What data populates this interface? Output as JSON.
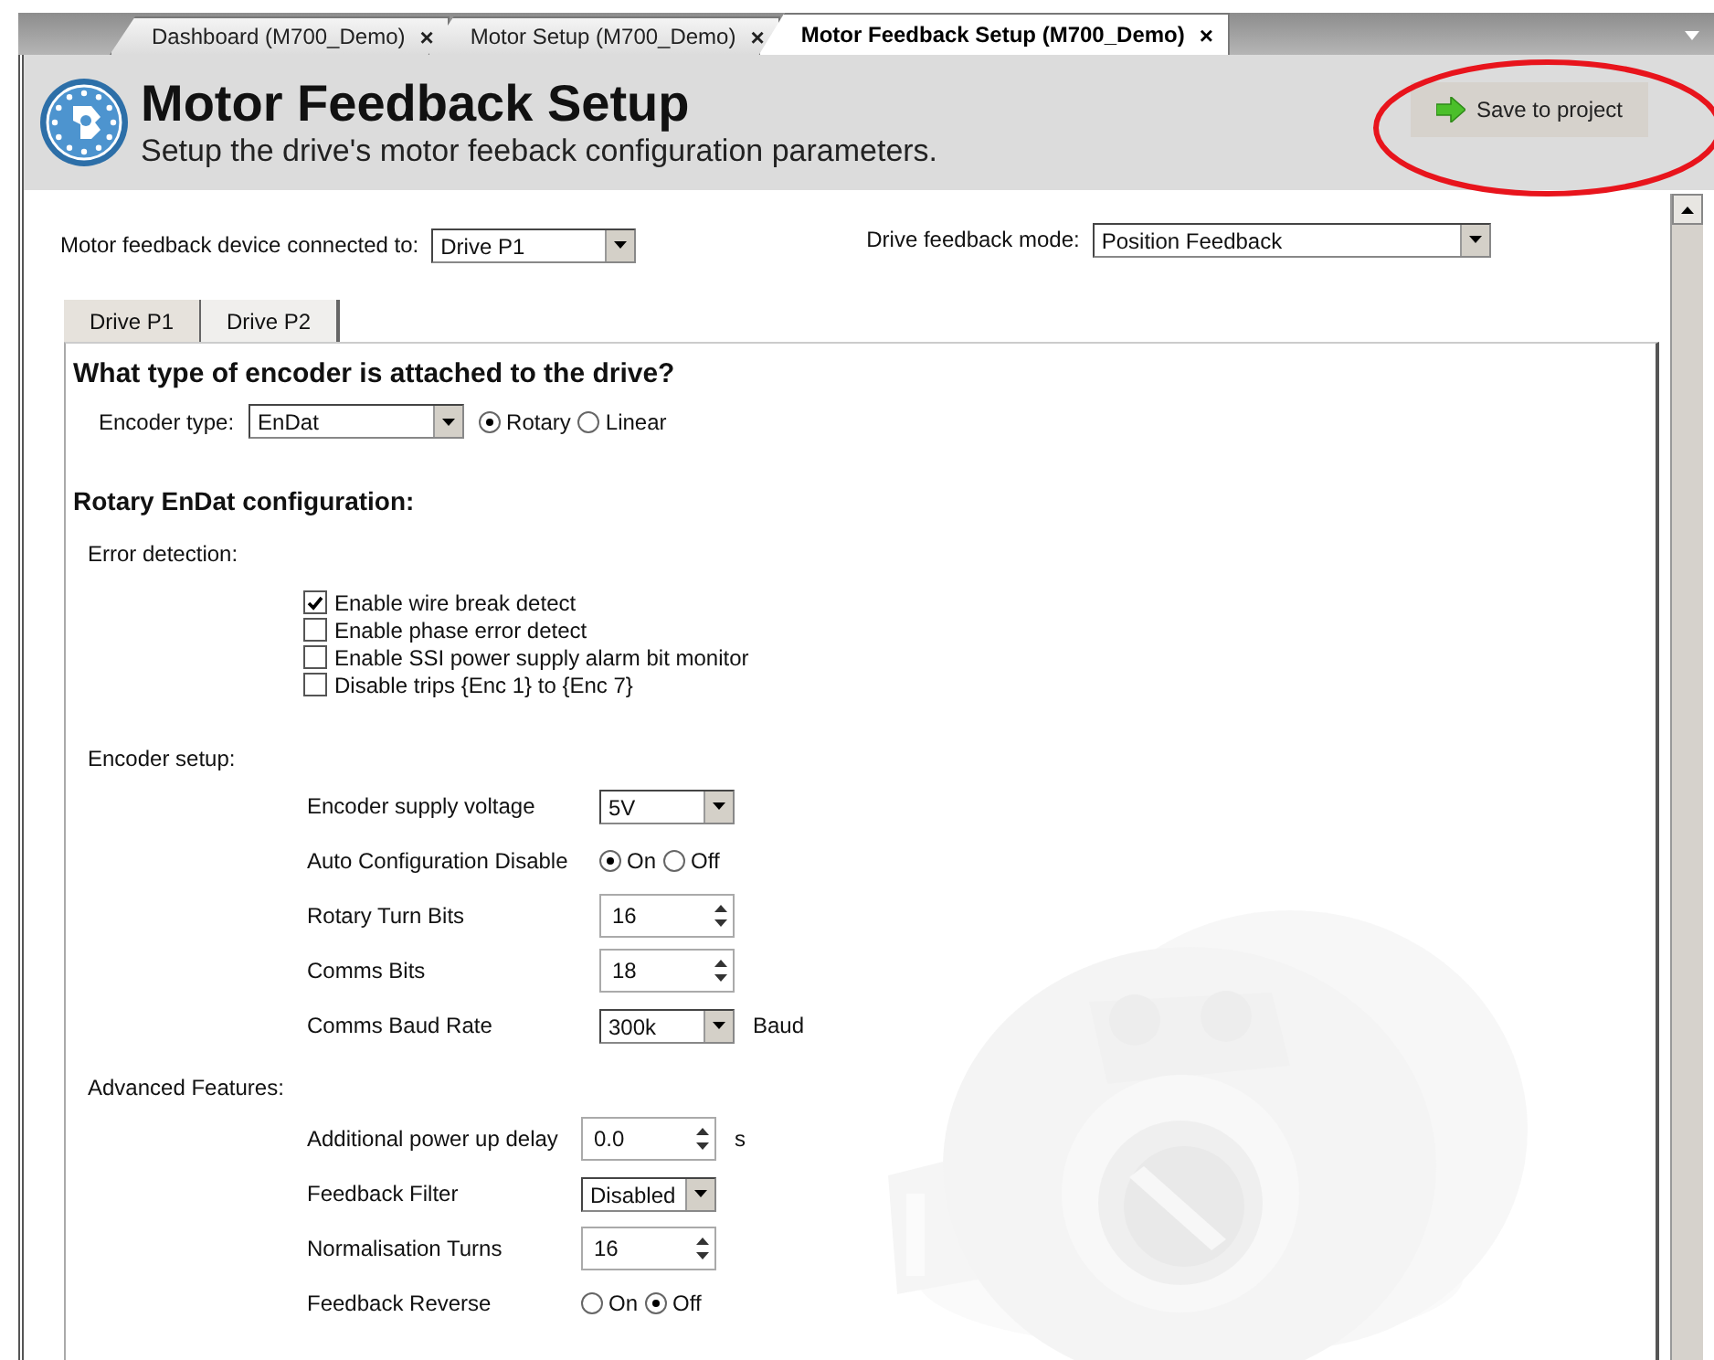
{
  "tabs": [
    {
      "label": "Dashboard (M700_Demo)",
      "close": "×",
      "selected": false
    },
    {
      "label": "Motor Setup (M700_Demo)",
      "close": "×",
      "selected": false
    },
    {
      "label": "Motor Feedback Setup (M700_Demo)",
      "close": "×",
      "selected": true
    }
  ],
  "header": {
    "title": "Motor Feedback Setup",
    "subtitle": "Setup the drive's motor feeback configuration parameters."
  },
  "save_button": {
    "label": "Save to project"
  },
  "top_fields": [
    {
      "label": "Motor feedback device connected to:",
      "value": "Drive P1"
    },
    {
      "label": "Drive feedback mode:",
      "value": "Position Feedback"
    }
  ],
  "drive_tabs": [
    {
      "label": "Drive P1",
      "selected": true
    },
    {
      "label": "Drive P2",
      "selected": false
    }
  ],
  "question": "What type of encoder is attached to the drive?",
  "encoder_type": {
    "label": "Encoder type:",
    "value": "EnDat",
    "options": [
      {
        "label": "Rotary",
        "selected": true
      },
      {
        "label": "Linear",
        "selected": false
      }
    ]
  },
  "config_heading": "Rotary EnDat configuration:",
  "error_detection": {
    "heading": "Error detection:",
    "items": [
      {
        "label": "Enable wire break detect",
        "checked": true
      },
      {
        "label": "Enable phase error detect",
        "checked": false
      },
      {
        "label": "Enable SSI power supply alarm bit monitor",
        "checked": false
      },
      {
        "label": "Disable trips {Enc 1} to {Enc 7}",
        "checked": false
      }
    ]
  },
  "encoder_setup": {
    "heading": "Encoder setup:",
    "rows": [
      {
        "kind": "dropdown",
        "label": "Encoder supply voltage",
        "value": "5V"
      },
      {
        "kind": "radio",
        "label": "Auto Configuration Disable",
        "options": [
          {
            "label": "On",
            "selected": true
          },
          {
            "label": "Off",
            "selected": false
          }
        ]
      },
      {
        "kind": "spinner",
        "label": "Rotary Turn Bits",
        "value": "16"
      },
      {
        "kind": "spinner",
        "label": "Comms Bits",
        "value": "18"
      },
      {
        "kind": "dropdown",
        "label": "Comms Baud Rate",
        "value": "300k",
        "unit": "Baud"
      }
    ]
  },
  "advanced": {
    "heading": "Advanced Features:",
    "rows": [
      {
        "kind": "spinner",
        "label": "Additional power up delay",
        "value": "0.0",
        "unit": "s"
      },
      {
        "kind": "dropdown",
        "label": "Feedback Filter",
        "value": "Disabled"
      },
      {
        "kind": "spinner",
        "label": "Normalisation Turns",
        "value": "16"
      },
      {
        "kind": "radio",
        "label": "Feedback Reverse",
        "options": [
          {
            "label": "On",
            "selected": false
          },
          {
            "label": "Off",
            "selected": true
          }
        ]
      }
    ]
  }
}
